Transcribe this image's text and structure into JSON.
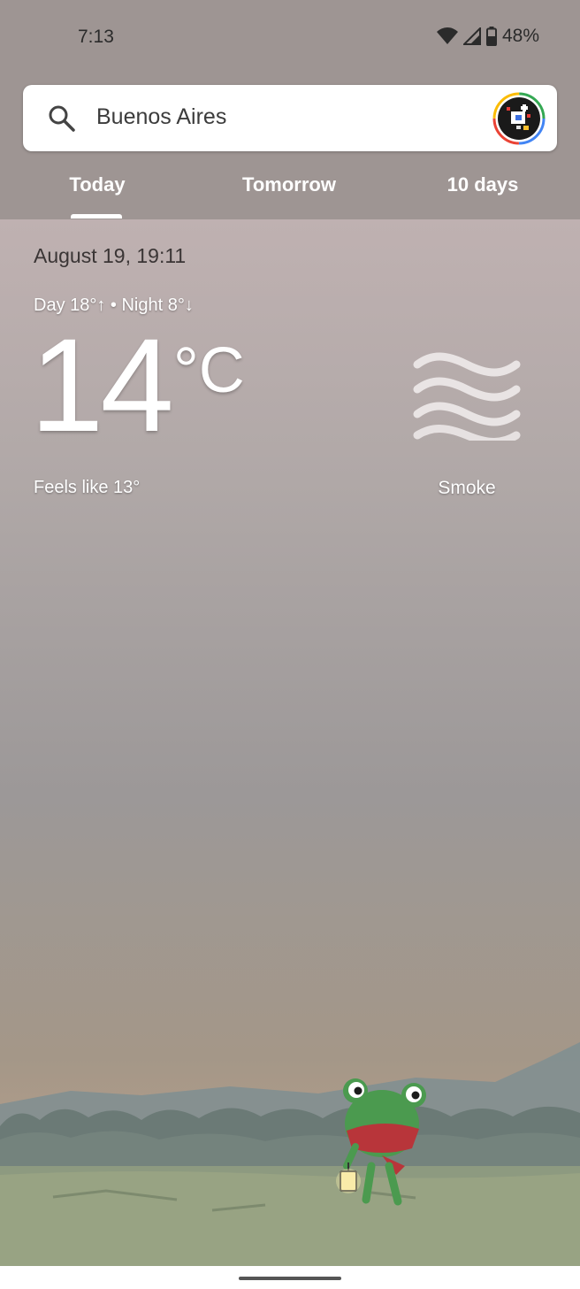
{
  "status_bar": {
    "time": "7:13",
    "battery": "48%"
  },
  "search": {
    "query": "Buenos Aires"
  },
  "tabs": [
    {
      "label": "Today"
    },
    {
      "label": "Tomorrow"
    },
    {
      "label": "10 days"
    }
  ],
  "current": {
    "datetime": "August 19, 19:11",
    "day_night": "Day 18°↑ • Night 8°↓",
    "temperature": "14",
    "unit": "°C",
    "feels_like": "Feels like 13°",
    "condition": "Smoke",
    "condition_icon": "smoke-icon"
  },
  "colors": {
    "header_bg": "#9e9593",
    "tab_text": "#ffffff"
  }
}
